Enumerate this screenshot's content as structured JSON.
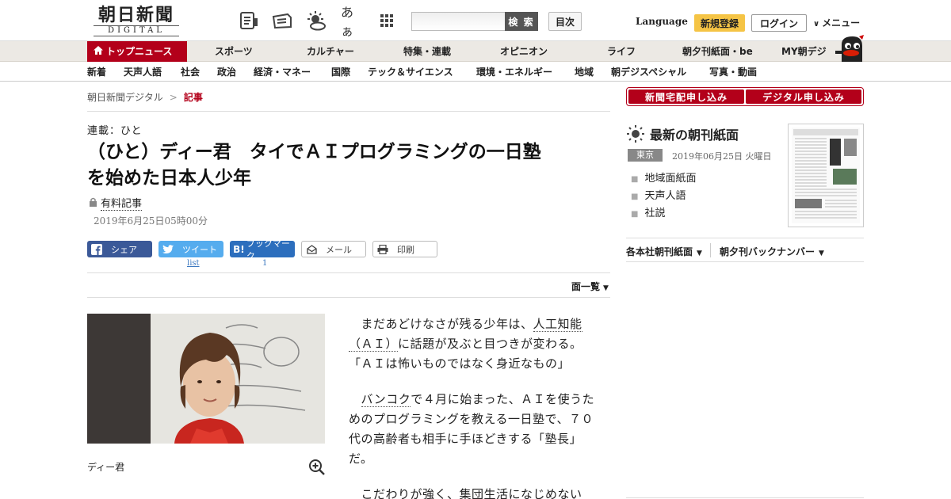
{
  "header": {
    "logo_ja": "朝日新聞",
    "logo_en": "DIGITAL",
    "icons": [
      "list-icon",
      "newspaper-icon",
      "weather-icon",
      "font-size-icon",
      "grid-icon"
    ],
    "font_size_label": "あぁ",
    "search": {
      "placeholder": "",
      "button_label": "検 索"
    },
    "toc_label": "目次",
    "language_label": "Language",
    "register_label": "新規登録",
    "login_label": "ログイン",
    "menu_label": "メニュー"
  },
  "main_nav": {
    "items": [
      "トップニュース",
      "スポーツ",
      "カルチャー",
      "特集・連載",
      "オピニオン",
      "ライフ",
      "朝夕刊紙面・be",
      "MY朝デジ"
    ],
    "active_color": "#b3001a"
  },
  "sub_nav": {
    "items": [
      "新着",
      "天声人語",
      "社会",
      "政治",
      "経済・マネー",
      "国際",
      "テック＆サイエンス",
      "環境・エネルギー",
      "地域",
      "朝デジスペシャル",
      "写真・動画"
    ]
  },
  "breadcrumb": {
    "home": "朝日新聞デジタル",
    "separator": ">",
    "current": "記事"
  },
  "article": {
    "series": "連載：ひと",
    "title_line1": "（ひと）ディー君　タイでＡＩプログラミングの一日塾",
    "title_line2": "を始めた日本人少年",
    "paid_label": "有料記事",
    "date": "2019年6月25日05時00分",
    "share": {
      "facebook": "シェア",
      "twitter": "ツイート",
      "hatena": "ブックマーク",
      "mail": "メール",
      "print": "印刷",
      "twitter_count": "list",
      "hatena_count": "1"
    },
    "layout_toggle": "面一覧",
    "photo_caption": "ディー君",
    "body": {
      "p1_a": "まだあどけなさが残る少年は、",
      "p1_kw1": "人工知能",
      "p1_kw2": "（ＡＩ）",
      "p1_b": "に話題が及ぶと目つきが変わる。「ＡＩは怖いものではなく身近なもの」",
      "p2_kw": "バンコク",
      "p2_a": "で４月に始まった、ＡＩを使うためのプログラミングを教える一日塾で、７０代の高齢者も相手に手ほどきする「塾長」だ。",
      "p3": "こだわりが強く、集団生活になじめない"
    }
  },
  "sidebar": {
    "subscribe_paper": "新聞宅配申し込み",
    "subscribe_digital": "デジタル申し込み",
    "latest_title": "最新の朝刊紙面",
    "region": "東京",
    "paper_date": "2019年06月25日 火曜日",
    "links": [
      "地域面紙面",
      "天声人語",
      "社説"
    ],
    "backnum_a": "各本社朝刊紙面",
    "backnum_b": "朝夕刊バックナンバー"
  }
}
